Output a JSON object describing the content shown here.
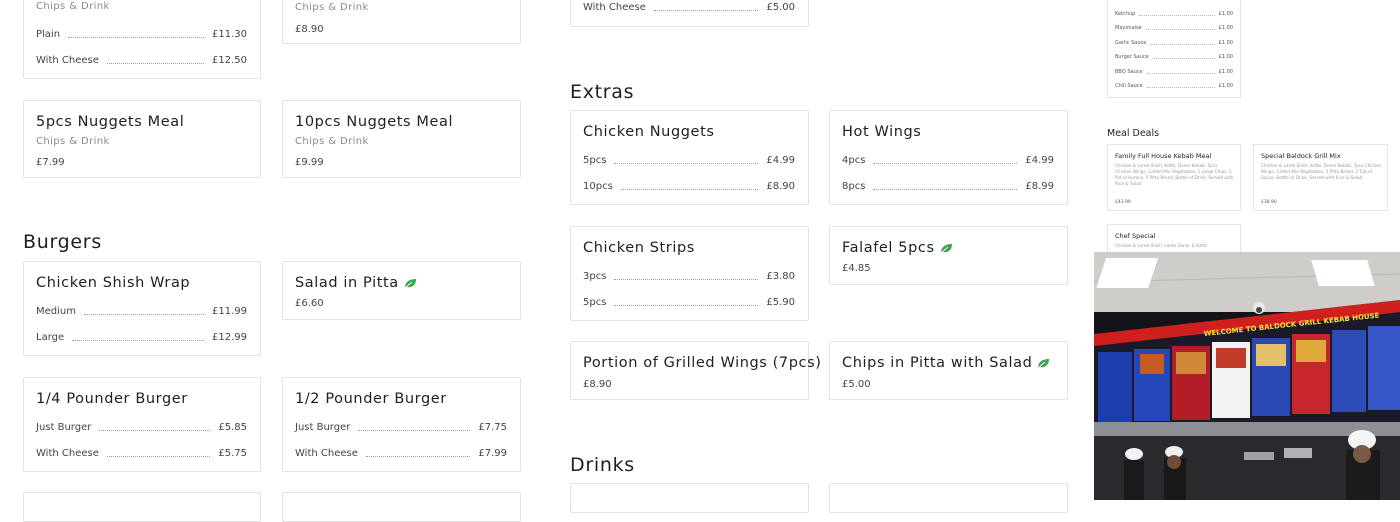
{
  "left_top": {
    "card_a": {
      "sub": "Chips & Drink",
      "options": [
        {
          "label": "Plain",
          "price": "£11.30"
        },
        {
          "label": "With Cheese",
          "price": "£12.50"
        }
      ]
    },
    "card_b": {
      "sub": "Chips & Drink",
      "price": "£8.90"
    },
    "card_c": {
      "title": "5pcs Nuggets Meal",
      "sub": "Chips & Drink",
      "price": "£7.99"
    },
    "card_d": {
      "title": "10pcs Nuggets Meal",
      "sub": "Chips & Drink",
      "price": "£9.99"
    }
  },
  "burgers": {
    "heading": "Burgers",
    "items": [
      {
        "title": "Chicken Shish Wrap",
        "options": [
          {
            "label": "Medium",
            "price": "£11.99"
          },
          {
            "label": "Large",
            "price": "£12.99"
          }
        ]
      },
      {
        "title": "Salad in Pitta",
        "price": "£6.60",
        "vegetarian": true
      },
      {
        "title": "1/4 Pounder Burger",
        "options": [
          {
            "label": "Just Burger",
            "price": "£5.85"
          },
          {
            "label": "With Cheese",
            "price": "£5.75"
          }
        ]
      },
      {
        "title": "1/2 Pounder Burger",
        "options": [
          {
            "label": "Just Burger",
            "price": "£7.75"
          },
          {
            "label": "With Cheese",
            "price": "£7.99"
          }
        ]
      }
    ]
  },
  "mid_top": {
    "option": {
      "label": "With Cheese",
      "price": "£5.00"
    }
  },
  "extras": {
    "heading": "Extras",
    "items": [
      {
        "title": "Chicken Nuggets",
        "options": [
          {
            "label": "5pcs",
            "price": "£4.99"
          },
          {
            "label": "10pcs",
            "price": "£8.90"
          }
        ]
      },
      {
        "title": "Hot Wings",
        "options": [
          {
            "label": "4pcs",
            "price": "£4.99"
          },
          {
            "label": "8pcs",
            "price": "£8.99"
          }
        ]
      },
      {
        "title": "Chicken Strips",
        "options": [
          {
            "label": "3pcs",
            "price": "£3.80"
          },
          {
            "label": "5pcs",
            "price": "£5.90"
          }
        ]
      },
      {
        "title": "Falafel 5pcs",
        "price": "£4.85",
        "vegetarian": true
      },
      {
        "title": "Portion of Grilled Wings (7pcs)",
        "price": "£8.90"
      },
      {
        "title": "Chips in Pitta with Salad",
        "price": "£5.00",
        "vegetarian": true
      }
    ]
  },
  "drinks": {
    "heading": "Drinks"
  },
  "mini_menu": {
    "sauces": [
      {
        "label": "Ketchup",
        "price": "£1.00"
      },
      {
        "label": "Mayonaise",
        "price": "£1.00"
      },
      {
        "label": "Garlic Sauce",
        "price": "£1.00"
      },
      {
        "label": "Burger Sauce",
        "price": "£1.00"
      },
      {
        "label": "BBQ Sauce",
        "price": "£1.00"
      },
      {
        "label": "Chili Sauce",
        "price": "£1.00"
      }
    ],
    "meal_deals_heading": "Meal Deals",
    "deals": [
      {
        "title": "Family Full House Kebab Meal",
        "desc": "Chicken & Lamb Shish, Kofte, Doner Kebab, 5pcs Chicken Wings, Grilled Mix Vegetables, 1 Large Chips, 1 Pot of Humus, 5 Pitta Bread, Bottle of Drink, Served with Rice & Salad",
        "price": "£43.99"
      },
      {
        "title": "Special Baldock Grill Mix",
        "desc": "Chicken & Lamb Shish, Kofte, Doner Kebab, 7pcs Chicken Wings, Grilled Mix Vegetables, 5 Pitta Bread, 2 Tub of Sauce, Bottle of Drink, Served with Rice & Salad",
        "price": "£38.90"
      },
      {
        "title": "Chef Special",
        "desc": "Chicken & Lamb Shish, Lamb Doner & Kofte",
        "price": ""
      }
    ]
  },
  "photo": {
    "banner": "WELCOME TO BALDOCK GRILL KEBAB HOUSE"
  }
}
